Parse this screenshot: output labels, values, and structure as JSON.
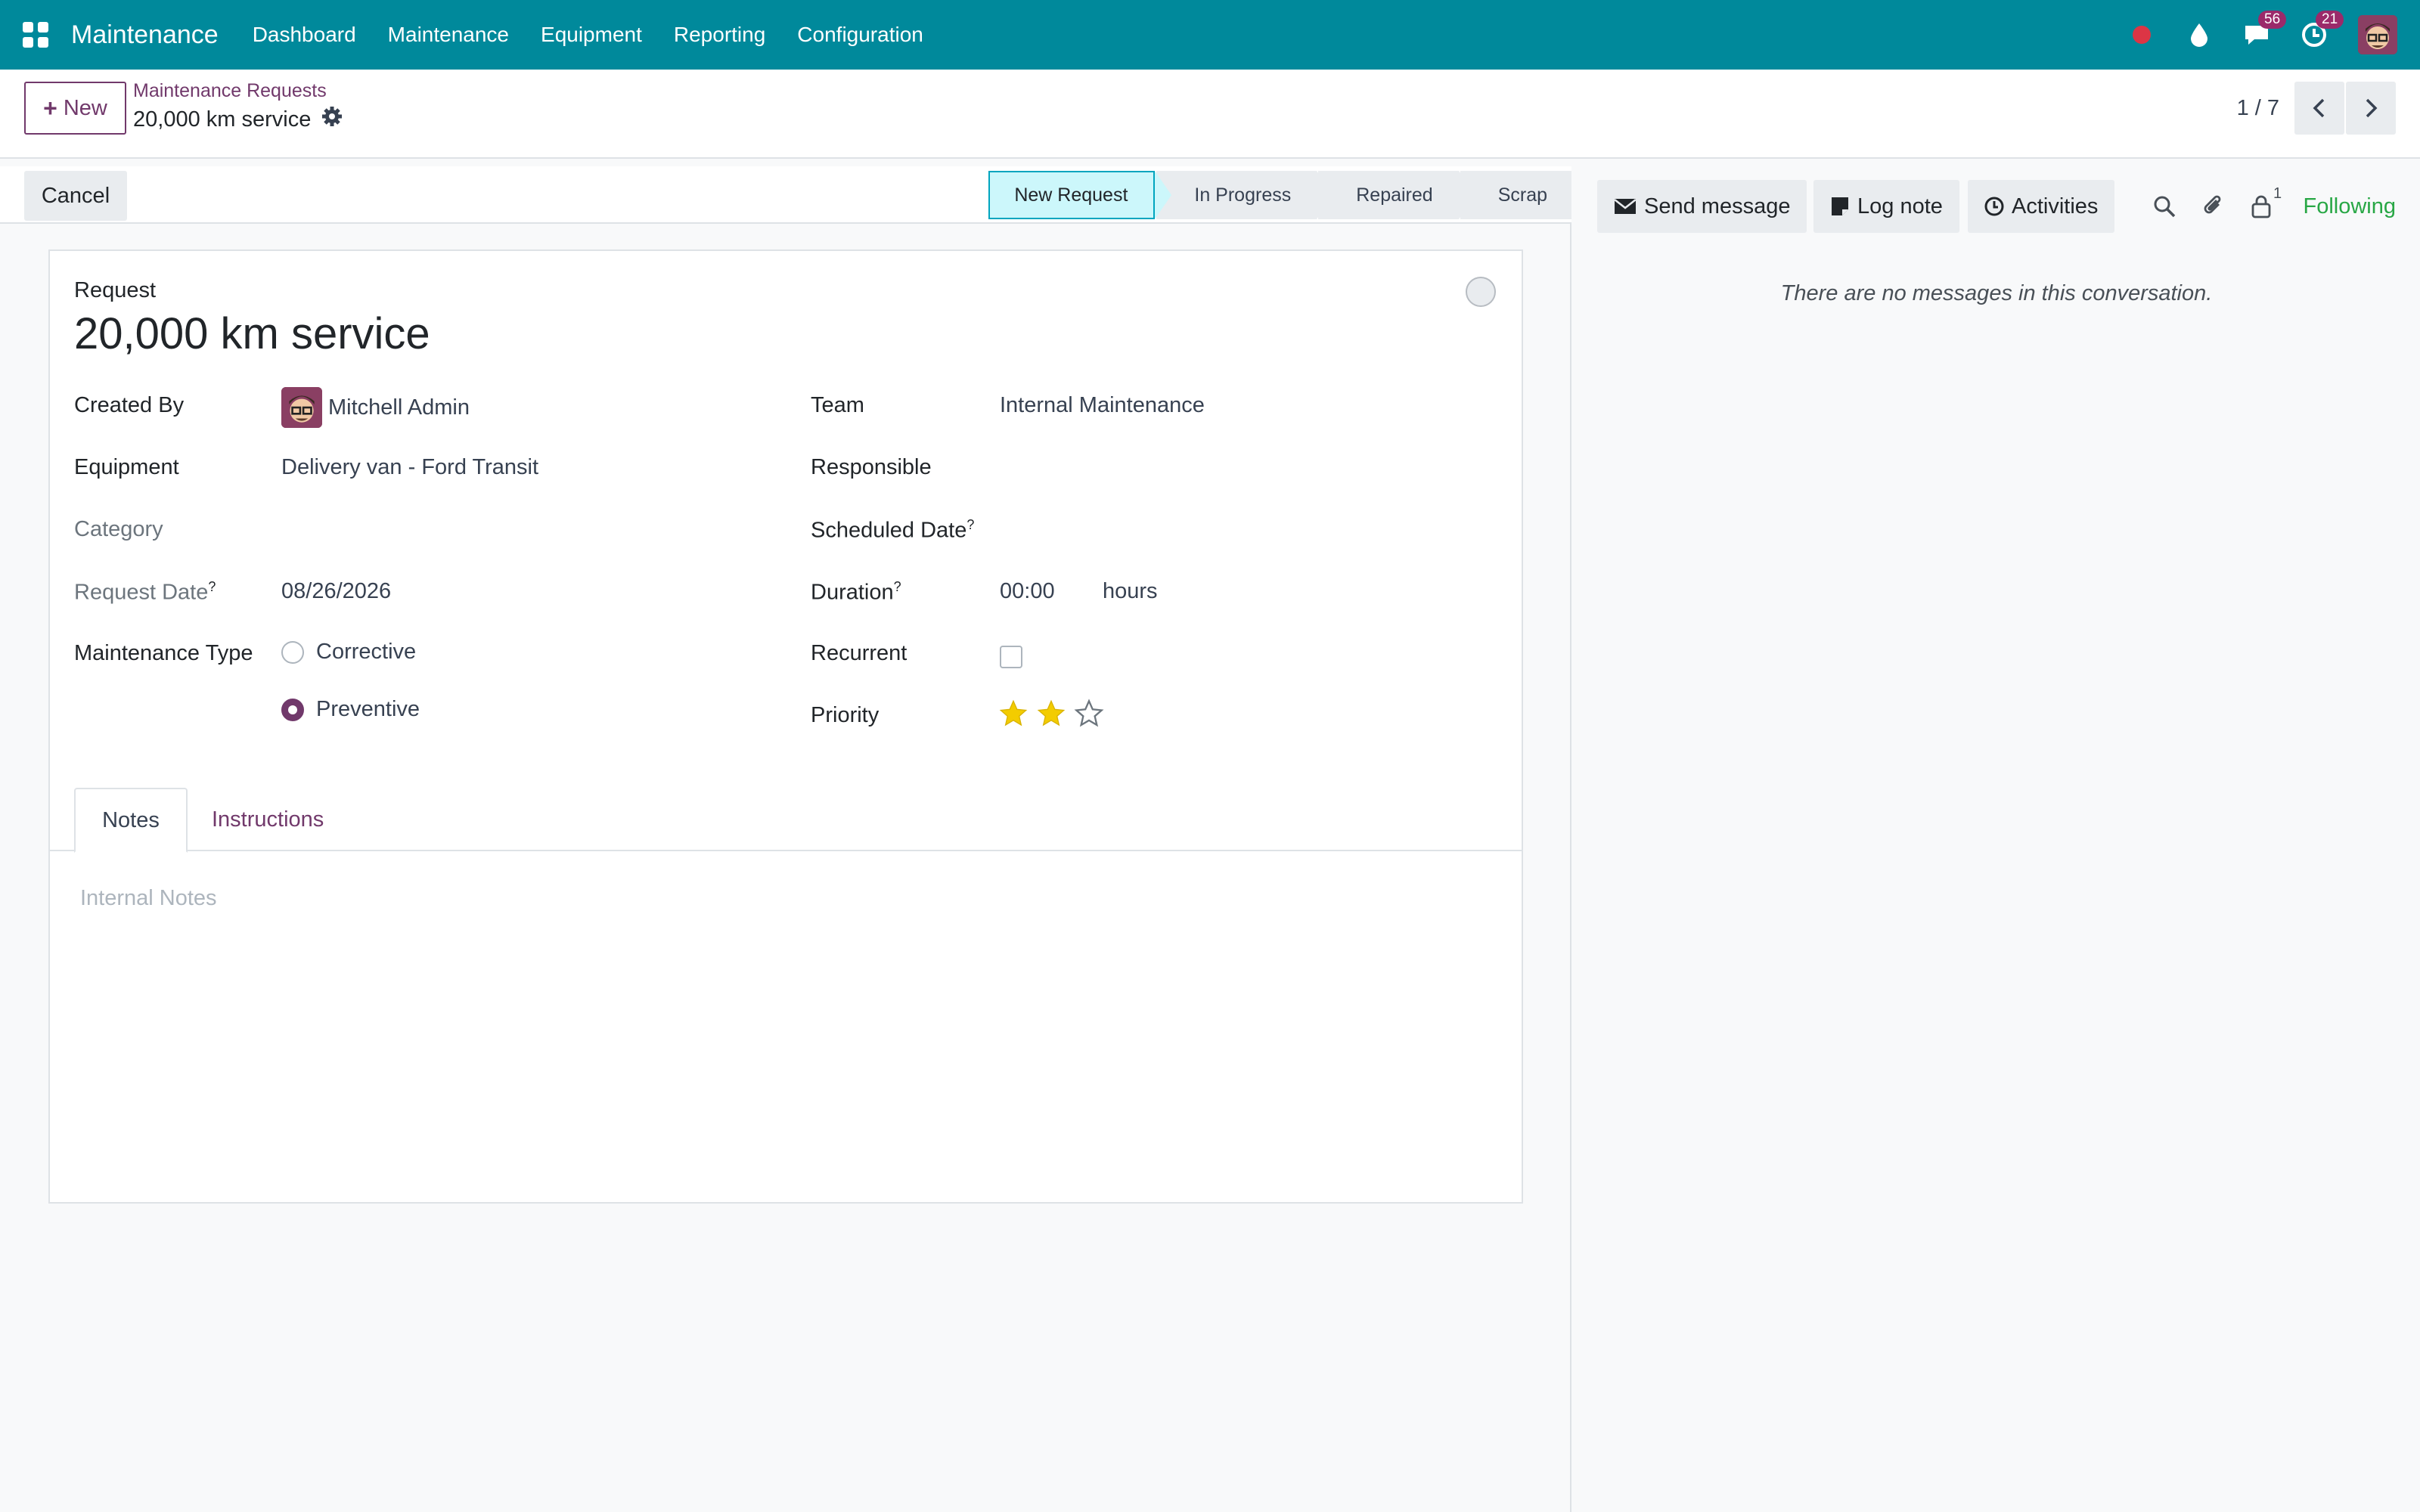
{
  "app": {
    "name": "Maintenance"
  },
  "navbar": {
    "items": [
      "Dashboard",
      "Maintenance",
      "Equipment",
      "Reporting",
      "Configuration"
    ],
    "messages_badge": "56",
    "activities_badge": "21"
  },
  "control": {
    "new_label": "New",
    "breadcrumb": "Maintenance Requests",
    "record_title": "20,000 km service",
    "pager_value": "1 / 7"
  },
  "statusbar": {
    "cancel_label": "Cancel",
    "stages": [
      "New Request",
      "In Progress",
      "Repaired",
      "Scrap"
    ],
    "active_stage": "New Request"
  },
  "form": {
    "request_label": "Request",
    "name": "20,000 km service",
    "left": {
      "created_by_label": "Created By",
      "created_by_value": "Mitchell Admin",
      "equipment_label": "Equipment",
      "equipment_value": "Delivery van - Ford Transit",
      "category_label": "Category",
      "request_date_label": "Request Date",
      "request_date_value": "08/26/2026",
      "maintenance_type_label": "Maintenance Type",
      "maintenance_type_options": [
        "Corrective",
        "Preventive"
      ],
      "maintenance_type_selected": "Preventive"
    },
    "right": {
      "team_label": "Team",
      "team_value": "Internal Maintenance",
      "responsible_label": "Responsible",
      "scheduled_date_label": "Scheduled Date",
      "duration_label": "Duration",
      "duration_value": "00:00",
      "duration_unit": "hours",
      "recurrent_label": "Recurrent",
      "recurrent_checked": false,
      "priority_label": "Priority",
      "priority_value": 2,
      "priority_max": 3
    },
    "tooltip_mark": "?",
    "tabs": [
      "Notes",
      "Instructions"
    ],
    "active_tab": "Notes",
    "notes_placeholder": "Internal Notes"
  },
  "chatter": {
    "send_message_label": "Send message",
    "log_note_label": "Log note",
    "activities_label": "Activities",
    "followers_count": "1",
    "following_label": "Following",
    "empty_message": "There are no messages in this conversation."
  },
  "colors": {
    "navbar": "#00899b",
    "brand_purple": "#71396b",
    "stage_active_bg": "#ccf7fb",
    "star_gold": "#f3cc00",
    "following_green": "#28a745"
  }
}
